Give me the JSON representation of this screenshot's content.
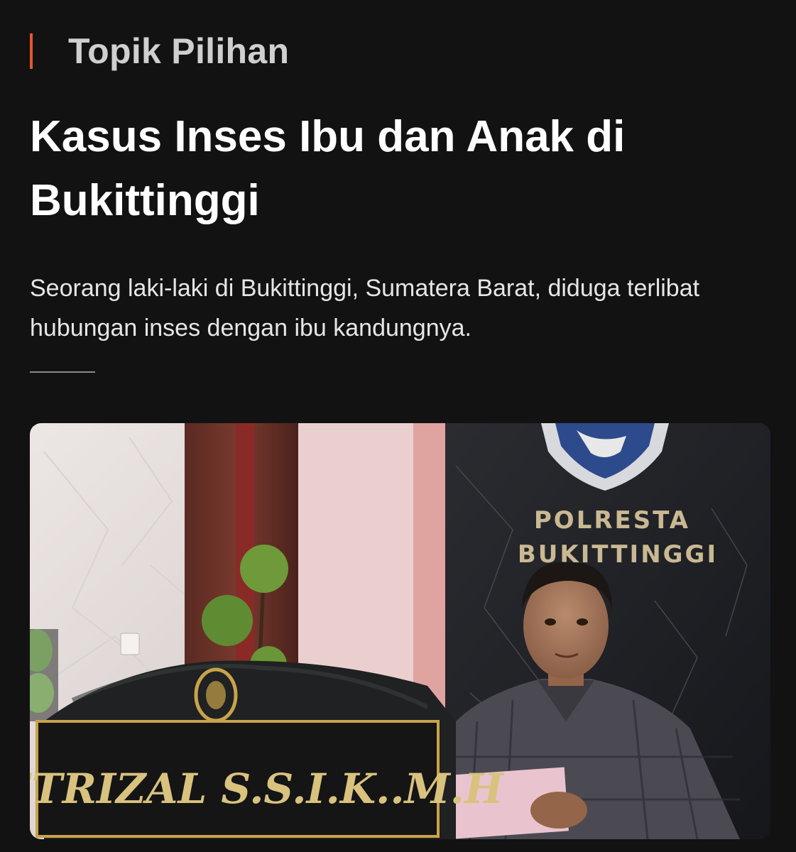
{
  "topic_section": {
    "title": "Topik Pilihan",
    "accent_color": "#e8552f"
  },
  "article": {
    "headline": "Kasus Inses Ibu dan Anak di Bukittinggi",
    "summary": "Seorang laki-laki di Bukittinggi, Sumatera Barat, diduga terlibat hubungan inses dengan ibu kandungnya.",
    "image": {
      "wall_sign_line1": "POLRESTA",
      "wall_sign_line2": "BUKITTINGGI",
      "nameplate_text": "FETRIZAL S.S.I.K..M.H"
    }
  }
}
